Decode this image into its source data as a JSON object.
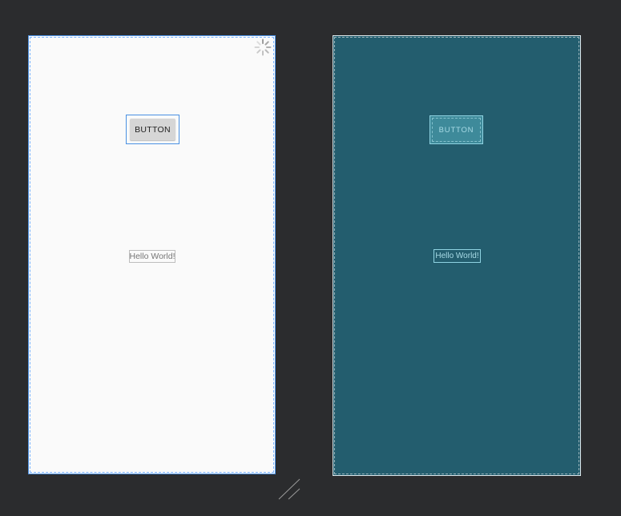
{
  "design_view": {
    "button_label": "BUTTON",
    "text_view": "Hello World!",
    "loading_icon": "spinner-icon"
  },
  "blueprint_view": {
    "button_label": "BUTTON",
    "text_view": "Hello World!"
  },
  "colors": {
    "canvas_background": "#2b2c2e",
    "design_surface": "#fafafa",
    "selection_outline": "#4a90e2",
    "blueprint_surface": "#235d6e",
    "blueprint_outline": "#8fd3e2"
  },
  "icons": {
    "resize_handle": "resize-handle-icon"
  }
}
